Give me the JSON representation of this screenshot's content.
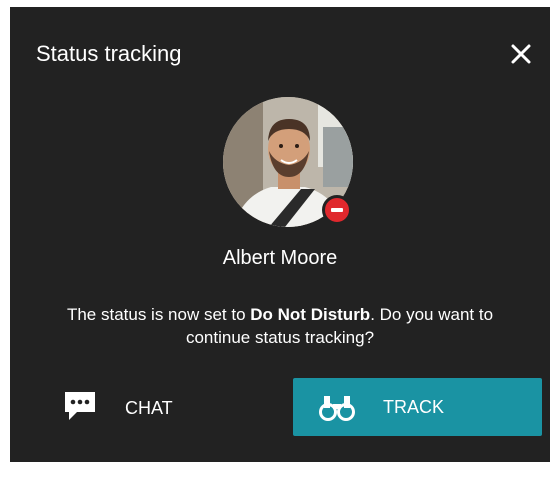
{
  "dialog": {
    "title": "Status tracking",
    "close_icon": "close-icon",
    "user": {
      "name": "Albert Moore",
      "status": "Do Not Disturb",
      "status_color": "#e0282d"
    },
    "message": {
      "prefix": "The status is now set to ",
      "status": "Do Not Disturb",
      "suffix": ". Do you want to continue status tracking?"
    },
    "actions": {
      "chat": {
        "label": "CHAT",
        "icon": "chat-icon"
      },
      "track": {
        "label": "TRACK",
        "icon": "binoculars-icon",
        "color": "#1a93a3"
      }
    }
  }
}
